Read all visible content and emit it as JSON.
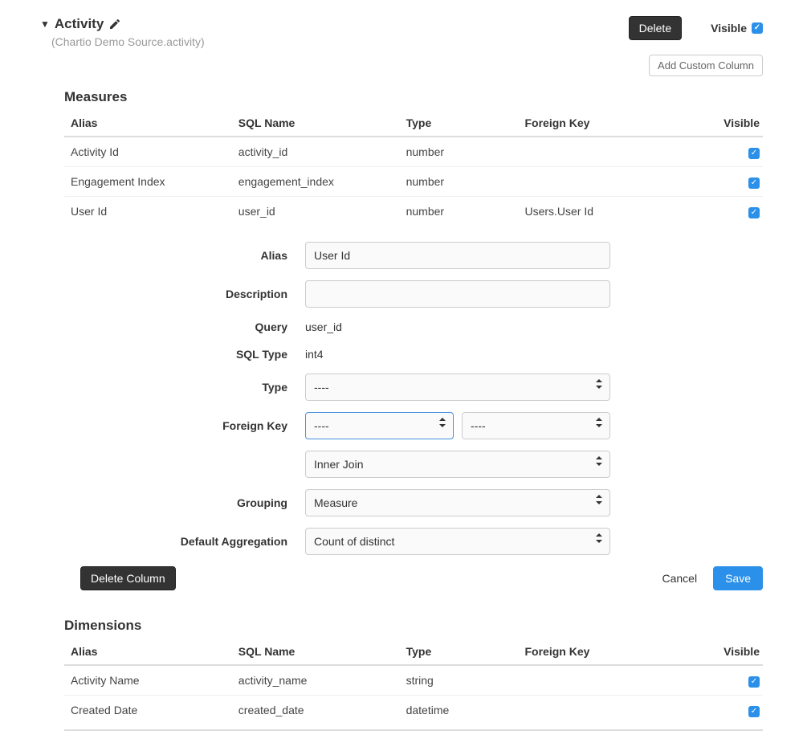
{
  "header": {
    "title": "Activity",
    "subtitle": "(Chartio Demo Source.activity)",
    "delete_label": "Delete",
    "visible_label": "Visible",
    "add_custom_column_label": "Add Custom Column"
  },
  "table_headers": {
    "alias": "Alias",
    "sql_name": "SQL Name",
    "type": "Type",
    "foreign_key": "Foreign Key",
    "visible": "Visible"
  },
  "measures": {
    "title": "Measures",
    "rows": [
      {
        "alias": "Activity Id",
        "sql_name": "activity_id",
        "type": "number",
        "foreign_key": "",
        "visible": true
      },
      {
        "alias": "Engagement Index",
        "sql_name": "engagement_index",
        "type": "number",
        "foreign_key": "",
        "visible": true
      },
      {
        "alias": "User Id",
        "sql_name": "user_id",
        "type": "number",
        "foreign_key": "Users.User Id",
        "visible": true
      }
    ]
  },
  "detail": {
    "labels": {
      "alias": "Alias",
      "description": "Description",
      "query": "Query",
      "sql_type": "SQL Type",
      "type": "Type",
      "foreign_key": "Foreign Key",
      "grouping": "Grouping",
      "default_aggregation": "Default Aggregation"
    },
    "values": {
      "alias": "User Id",
      "description": "",
      "query": "user_id",
      "sql_type": "int4",
      "type": "----",
      "foreign_key_1": "----",
      "foreign_key_2": "----",
      "join_type": "Inner Join",
      "grouping": "Measure",
      "default_aggregation": "Count of distinct"
    },
    "actions": {
      "delete_column": "Delete Column",
      "cancel": "Cancel",
      "save": "Save"
    }
  },
  "dimensions": {
    "title": "Dimensions",
    "rows": [
      {
        "alias": "Activity Name",
        "sql_name": "activity_name",
        "type": "string",
        "foreign_key": "",
        "visible": true
      },
      {
        "alias": "Created Date",
        "sql_name": "created_date",
        "type": "datetime",
        "foreign_key": "",
        "visible": true
      }
    ]
  }
}
